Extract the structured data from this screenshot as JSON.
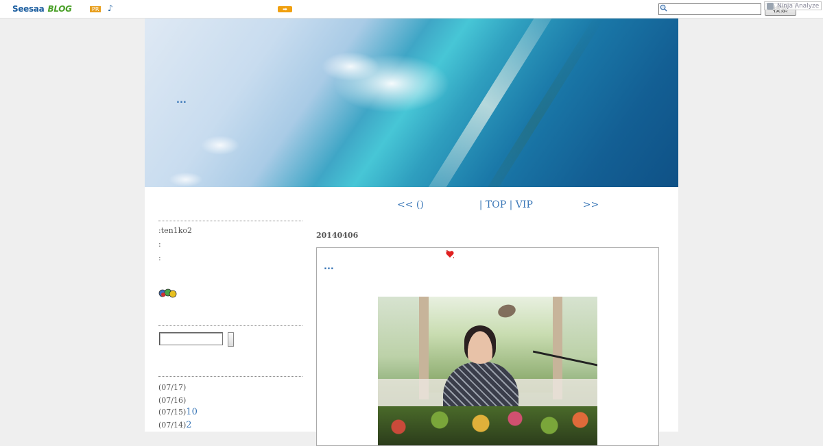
{
  "topbar": {
    "logo_seesaa": "Seesaa",
    "logo_blog": "BLOG",
    "pr_badge": "PR",
    "music_note": "♪",
    "arrow_label": "➡",
    "search_placeholder": "",
    "search_button": "検索",
    "ninja_label": "Ninja Analyze"
  },
  "banner": {
    "title": "..."
  },
  "sidebar": {
    "profile_name": ":ten1ko2",
    "profile_line2": ":",
    "profile_line3": ":",
    "recent_entries": [
      {
        "date": "(07/17)",
        "count": ""
      },
      {
        "date": "(07/16)",
        "count": ""
      },
      {
        "date": "(07/15)",
        "count": "10"
      },
      {
        "date": "(07/14)",
        "count": "2"
      }
    ]
  },
  "nav": {
    "prev": "<< ()",
    "sep1": "|",
    "top": "TOP",
    "sep2": "|",
    "vip": "VIP",
    "next": ">>"
  },
  "post": {
    "date": "20140406",
    "title": "..."
  },
  "colors": {
    "link": "#3a77b7",
    "page_bg": "#efefef",
    "content_bg": "#ffffff",
    "logo_blue": "#1d5fa0",
    "logo_green": "#4aa028",
    "pr_orange": "#e8a020"
  },
  "icons": {
    "search": "magnifier-icon",
    "heart": "heart-icon",
    "subscribe": "rss-reader-icon",
    "music": "music-note-icon",
    "arrow": "arrow-right-icon"
  }
}
